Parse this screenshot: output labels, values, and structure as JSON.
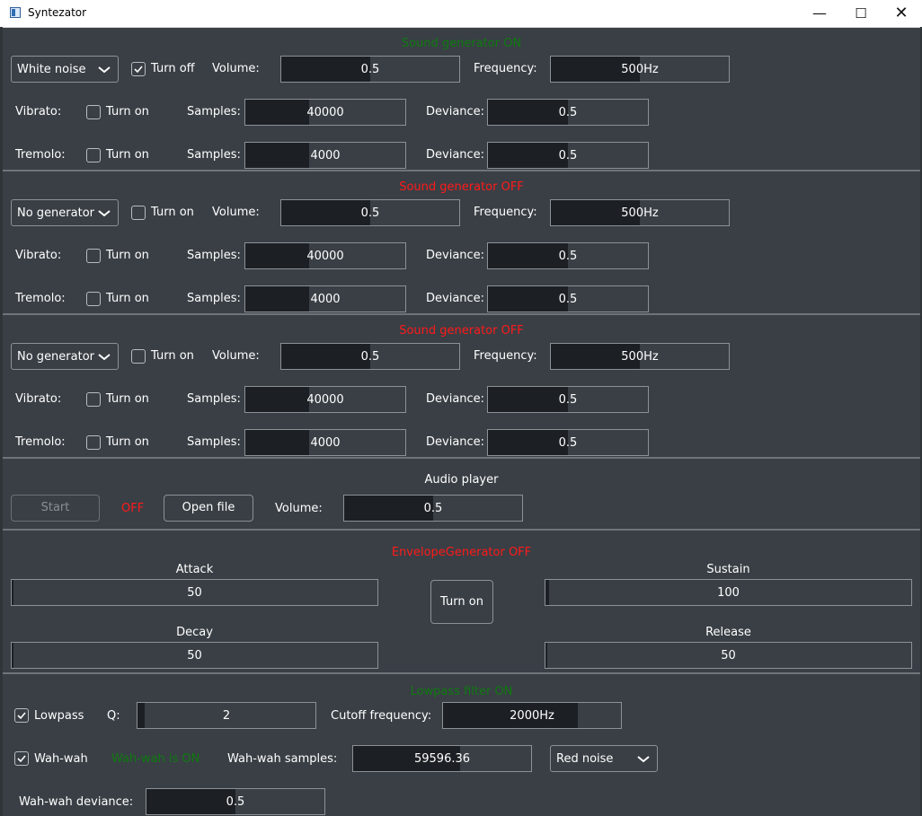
{
  "window": {
    "title": "Syntezator"
  },
  "generators": [
    {
      "status": "Sound generator ON",
      "status_on": true,
      "type": "White noise",
      "toggle_label": "Turn off",
      "toggle_checked": true,
      "volume_label": "Volume:",
      "volume_value": "0.5",
      "volume_level": 0.5,
      "frequency_label": "Frequency:",
      "frequency_value": "500Hz",
      "frequency_level": 0.5,
      "vibrato": {
        "label": "Vibrato:",
        "toggle_label": "Turn on",
        "checked": false,
        "samples_label": "Samples:",
        "samples_value": "40000",
        "samples_level": 0.4,
        "deviance_label": "Deviance:",
        "deviance_value": "0.5",
        "deviance_level": 0.5
      },
      "tremolo": {
        "label": "Tremolo:",
        "toggle_label": "Turn on",
        "checked": false,
        "samples_label": "Samples:",
        "samples_value": "4000",
        "samples_level": 0.4,
        "deviance_label": "Deviance:",
        "deviance_value": "0.5",
        "deviance_level": 0.5
      }
    },
    {
      "status": "Sound generator OFF",
      "status_on": false,
      "type": "No generator",
      "toggle_label": "Turn on",
      "toggle_checked": false,
      "volume_label": "Volume:",
      "volume_value": "0.5",
      "volume_level": 0.5,
      "frequency_label": "Frequency:",
      "frequency_value": "500Hz",
      "frequency_level": 0.5,
      "vibrato": {
        "label": "Vibrato:",
        "toggle_label": "Turn on",
        "checked": false,
        "samples_label": "Samples:",
        "samples_value": "40000",
        "samples_level": 0.4,
        "deviance_label": "Deviance:",
        "deviance_value": "0.5",
        "deviance_level": 0.5
      },
      "tremolo": {
        "label": "Tremolo:",
        "toggle_label": "Turn on",
        "checked": false,
        "samples_label": "Samples:",
        "samples_value": "4000",
        "samples_level": 0.4,
        "deviance_label": "Deviance:",
        "deviance_value": "0.5",
        "deviance_level": 0.5
      }
    },
    {
      "status": "Sound generator OFF",
      "status_on": false,
      "type": "No generator",
      "toggle_label": "Turn on",
      "toggle_checked": false,
      "volume_label": "Volume:",
      "volume_value": "0.5",
      "volume_level": 0.5,
      "frequency_label": "Frequency:",
      "frequency_value": "500Hz",
      "frequency_level": 0.5,
      "vibrato": {
        "label": "Vibrato:",
        "toggle_label": "Turn on",
        "checked": false,
        "samples_label": "Samples:",
        "samples_value": "40000",
        "samples_level": 0.4,
        "deviance_label": "Deviance:",
        "deviance_value": "0.5",
        "deviance_level": 0.5
      },
      "tremolo": {
        "label": "Tremolo:",
        "toggle_label": "Turn on",
        "checked": false,
        "samples_label": "Samples:",
        "samples_value": "4000",
        "samples_level": 0.4,
        "deviance_label": "Deviance:",
        "deviance_value": "0.5",
        "deviance_level": 0.5
      }
    }
  ],
  "audio_player": {
    "title": "Audio player",
    "start_label": "Start",
    "status": "OFF",
    "open_file_label": "Open file",
    "volume_label": "Volume:",
    "volume_value": "0.5",
    "volume_level": 0.5
  },
  "envelope": {
    "status": "EnvelopeGenerator  OFF",
    "toggle_label": "Turn on",
    "attack_label": "Attack",
    "attack_value": "50",
    "attack_level": 0.005,
    "decay_label": "Decay",
    "decay_value": "50",
    "decay_level": 0.005,
    "sustain_label": "Sustain",
    "sustain_value": "100",
    "sustain_level": 0.01,
    "release_label": "Release",
    "release_value": "50",
    "release_level": 0.005
  },
  "filter": {
    "status": "Lowpass filter ON",
    "lowpass_label": "Lowpass",
    "lowpass_checked": true,
    "q_label": "Q:",
    "q_value": "2",
    "q_level": 0.04,
    "cutoff_label": "Cutoff frequency:",
    "cutoff_value": "2000Hz",
    "cutoff_level": 0.76,
    "wahwah_label": "Wah-wah",
    "wahwah_checked": true,
    "wahwah_status": "Wah-wah is ON",
    "wahwah_samples_label": "Wah-wah samples:",
    "wahwah_samples_value": "59596.36",
    "wahwah_samples_level": 0.6,
    "wahwah_noise": "Red noise",
    "wahwah_deviance_label": "Wah-wah deviance:",
    "wahwah_deviance_value": "0.5",
    "wahwah_deviance_level": 0.5
  },
  "colors": {
    "background": "#393f45",
    "status_on": "#0f7a0f",
    "status_off": "#ff1a1a",
    "slider_fill": "#1c2024"
  }
}
